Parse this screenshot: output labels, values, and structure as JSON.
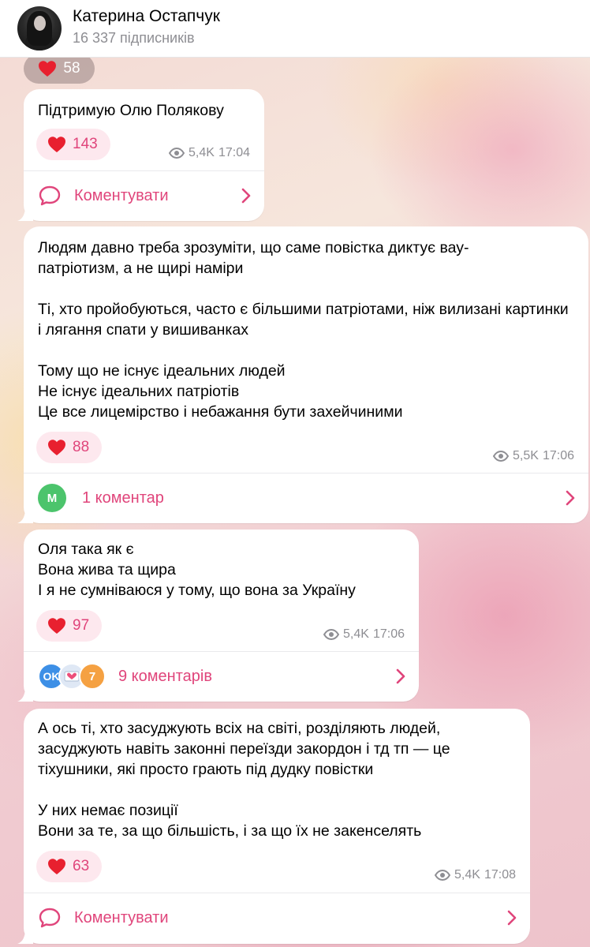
{
  "header": {
    "channel_name": "Катерина Остапчук",
    "subscribers": "16 337 підписників"
  },
  "top_reaction": {
    "icon": "heart-icon",
    "count": "58"
  },
  "posts": [
    {
      "text": "Підтримую Олю Полякову",
      "reaction_count": "143",
      "views": "5,4K",
      "time": "17:04",
      "footer_label": "Коментувати"
    },
    {
      "text": "Людям давно треба зрозуміти, що саме повістка диктує вау-\nпатріотизм, а не щирі наміри\n\nТі, хто пройобуються, часто є більшими патріотами, ніж вилизані картинки і лягання спати у вишиванках\n\nТому що не існує ідеальних людей\nНе існує ідеальних патріотів\nЦе все лицемірство і небажання бути захейчиними",
      "reaction_count": "88",
      "views": "5,5K",
      "time": "17:06",
      "footer_label": "1 коментар",
      "commenter_initial": "M"
    },
    {
      "text": "Оля така як є\nВона жива та щира\nІ я не сумніваюся у тому, що вона за Україну",
      "reaction_count": "97",
      "views": "5,4K",
      "time": "17:06",
      "footer_label": "9 коментарів",
      "commenters": [
        "OK",
        "",
        "7"
      ]
    },
    {
      "text": "А ось ті, хто засуджують всіх на світі, розділяють людей, засуджують навіть законні переїзди закордон і тд тп — це тіхушники, які просто грають під дудку повістки\n\nУ них немає позиції\nВони за те, за що більшість, і за що їх не закенселять",
      "reaction_count": "63",
      "views": "5,4K",
      "time": "17:08",
      "footer_label": "Коментувати"
    }
  ],
  "colors": {
    "accent": "#e0457b",
    "reaction_bg": "#fde8ee",
    "meta": "#8e8e93",
    "avatar_green": "#4cc46c",
    "avatar_blue": "#3d8fe6",
    "avatar_orange": "#f5a142"
  }
}
